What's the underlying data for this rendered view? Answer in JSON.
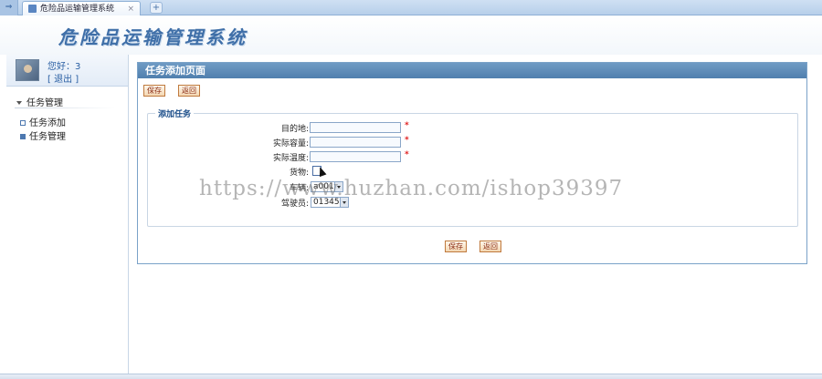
{
  "browser": {
    "tab_title": "危险品运输管理系统",
    "tab_close": "×",
    "new_tab": "+"
  },
  "app": {
    "banner_title": "危险品运输管理系统"
  },
  "user": {
    "greeting": "您好：3",
    "logout": "[ 退出 ]"
  },
  "sidebar": {
    "section_title": "任务管理",
    "items": [
      {
        "label": "任务添加"
      },
      {
        "label": "任务管理"
      }
    ]
  },
  "panel": {
    "title": "任务添加页面",
    "save_label": "保存",
    "back_label": "返回",
    "fieldset_legend": "添加任务",
    "fields": {
      "destination_label": "目的地:",
      "destination_value": "",
      "actual_weight_label": "实际容量:",
      "actual_weight_value": "",
      "actual_temp_label": "实际温度:",
      "actual_temp_value": "",
      "goods_label": "货物:",
      "vehicle_label": "车辆:",
      "vehicle_value": "a001",
      "driver_label": "驾驶员:",
      "driver_value": "01345"
    },
    "required_mark": "*"
  },
  "overlay": {
    "watermark": "https://www.huzhan.com/ishop39397"
  }
}
